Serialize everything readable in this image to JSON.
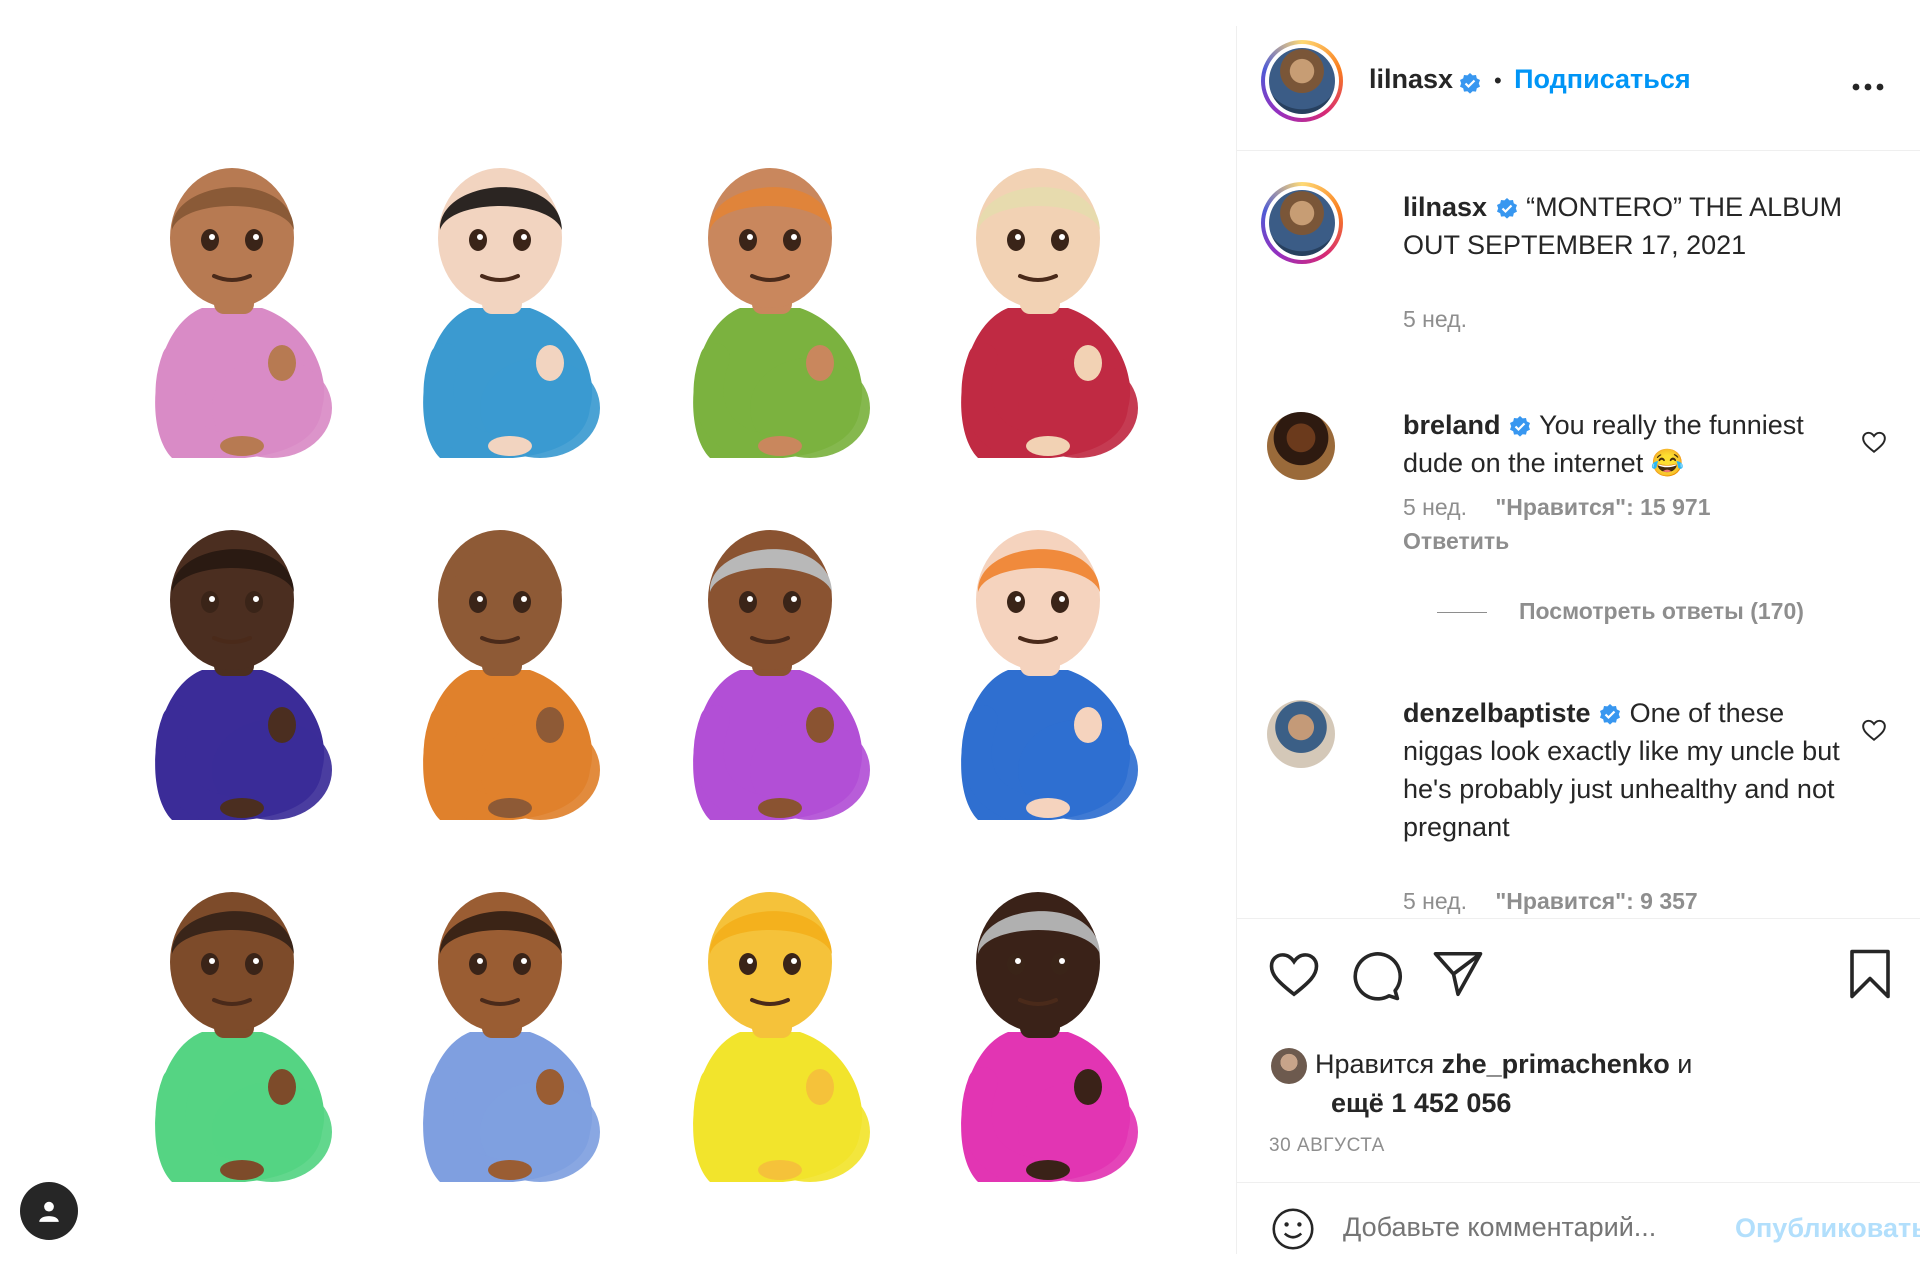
{
  "post": {
    "username": "lilnasx",
    "separator": "•",
    "follow_label": "Подписаться",
    "caption": "“MONTERO” THE ALBUM OUT SEPTEMBER 17, 2021",
    "caption_time": "5 нед."
  },
  "media": {
    "emoji_grid": [
      {
        "shirt": "#d98bc6",
        "skin": "#b77a52",
        "hair": "#8a5a37"
      },
      {
        "shirt": "#3b9ad0",
        "skin": "#f2d4c0",
        "hair": "#2b2522"
      },
      {
        "shirt": "#7bb23f",
        "skin": "#c9875d",
        "hair": "#e0843a"
      },
      {
        "shirt": "#c02a43",
        "skin": "#f2d2b4",
        "hair": "#e7dbae"
      },
      {
        "shirt": "#3b2c98",
        "skin": "#4b2e20",
        "hair": "#2a1a12"
      },
      {
        "shirt": "#e0812c",
        "skin": "#8e5a36",
        "hair": "#8e5a36"
      },
      {
        "shirt": "#b24fd6",
        "skin": "#8a5331",
        "hair": "#b8b8b8"
      },
      {
        "shirt": "#2f6fd0",
        "skin": "#f5d3be",
        "hair": "#f08a3c"
      },
      {
        "shirt": "#55d483",
        "skin": "#7d4b2a",
        "hair": "#3a2519"
      },
      {
        "shirt": "#7f9fe0",
        "skin": "#9a5d33",
        "hair": "#3b2416"
      },
      {
        "shirt": "#f2e42c",
        "skin": "#f5c23a",
        "hair": "#f4b11d"
      },
      {
        "shirt": "#e235b3",
        "skin": "#3a2218",
        "hair": "#b0b0b0"
      }
    ]
  },
  "comments": [
    {
      "username": "breland",
      "text": "You really the funniest dude on the internet 😂",
      "time": "5 нед.",
      "likes_label": "\"Нравится\": 15 971",
      "reply_label": "Ответить",
      "view_replies": "Посмотреть ответы (170)"
    },
    {
      "username": "denzelbaptiste",
      "text": "One of these niggas look exactly like my uncle but he's probably just unhealthy and not pregnant",
      "time": "5 нед.",
      "likes_label": "\"Нравится\": 9 357"
    }
  ],
  "likes": {
    "prefix": "Нравится",
    "user": "zhe_primachenko",
    "and": "и",
    "more": "ещё 1 452 056"
  },
  "date": "30 АВГУСТА",
  "add_comment": {
    "placeholder": "Добавьте комментарий...",
    "publish_label": "Опубликовать"
  },
  "icons": {
    "more": "more-horizontal-icon",
    "like": "heart-icon",
    "comment": "comment-icon",
    "share": "paper-plane-icon",
    "save": "bookmark-icon",
    "emoji": "smiley-icon",
    "tag": "user-tag-icon",
    "verified": "verified-badge-icon"
  },
  "colors": {
    "accent": "#0095f6",
    "publish_disabled": "#b2dffc",
    "verified": "#3897f0",
    "muted": "#8e8e8e"
  }
}
